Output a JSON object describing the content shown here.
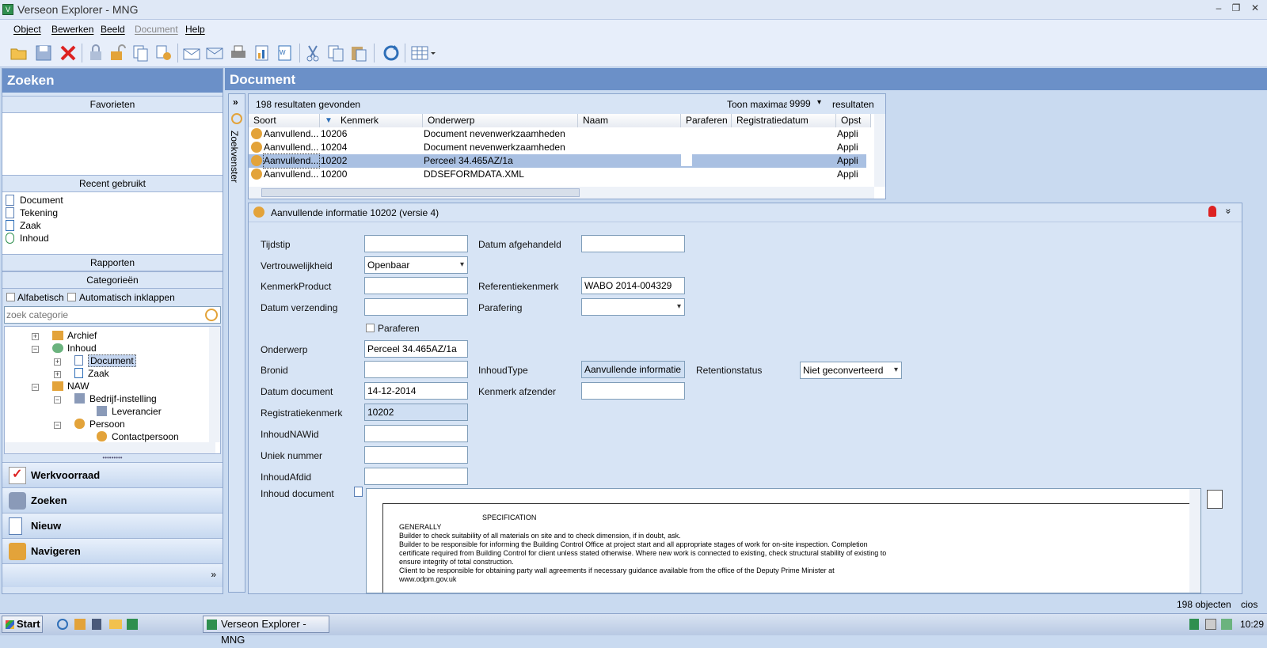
{
  "window": {
    "title": "Verseon Explorer - MNG",
    "app_icon": "verseon-app-icon"
  },
  "menu": [
    "Object",
    "Bewerken",
    "Beeld",
    "Document",
    "Help"
  ],
  "toolbar": [
    "open-folder-icon",
    "save-icon",
    "delete-icon",
    "lock-icon",
    "unlock-icon",
    "copy-doc-icon",
    "check-out-icon",
    "mail-open-icon",
    "mail-send-icon",
    "print-icon",
    "report-icon",
    "word-icon",
    "excel-icon",
    "cut-icon",
    "copy-icon",
    "paste-icon",
    "refresh-icon",
    "grid-view-icon"
  ],
  "left": {
    "title": "Zoeken",
    "favorieten": "Favorieten",
    "recent_title": "Recent gebruikt",
    "recent": [
      "Document",
      "Tekening",
      "Zaak",
      "Inhoud"
    ],
    "rapporten": "Rapporten",
    "categorieen": "Categorieën",
    "alfabetisch": "Alfabetisch",
    "auto_inklappen": "Automatisch inklappen",
    "search_placeholder": "zoek categorie",
    "tree": [
      "Archief",
      "Inhoud",
      "Document",
      "Zaak",
      "NAW",
      "Bedrijf-instelling",
      "Leverancier",
      "Persoon",
      "Contactpersoon"
    ],
    "nav": [
      "Werkvoorraad",
      "Zoeken",
      "Nieuw",
      "Navigeren"
    ]
  },
  "right": {
    "title": "Document",
    "zoekvenster": "Zoekvenster",
    "results_text": "198 resultaten gevonden",
    "toon_maximaal": "Toon maximaal",
    "max_value": "9999",
    "resultaten": "resultaten",
    "columns": [
      "Soort",
      "Kenmerk",
      "Onderwerp",
      "Naam",
      "Paraferen",
      "Registratiedatum",
      "Opst"
    ],
    "rows": [
      {
        "soort": "Aanvullend...",
        "kenmerk": "10206",
        "onderwerp": "Document nevenwerkzaamheden",
        "opst": "Appli"
      },
      {
        "soort": "Aanvullend...",
        "kenmerk": "10204",
        "onderwerp": "Document nevenwerkzaamheden",
        "opst": "Appli"
      },
      {
        "soort": "Aanvullend...",
        "kenmerk": "10202",
        "onderwerp": "Perceel 34.465AZ/1a",
        "opst": "Appli"
      },
      {
        "soort": "Aanvullend...",
        "kenmerk": "10200",
        "onderwerp": "DDSEFORMDATA.XML",
        "opst": "Appli"
      }
    ],
    "detail_title": "Aanvullende informatie 10202 (versie 4)",
    "form": {
      "tijdstip": "Tijdstip",
      "vertrouwelijkheid": "Vertrouwelijkheid",
      "vertrouwelijkheid_val": "Openbaar",
      "kenmerkproduct": "KenmerkProduct",
      "datum_verzending": "Datum verzending",
      "paraferen": "Paraferen",
      "onderwerp": "Onderwerp",
      "onderwerp_val": "Perceel 34.465AZ/1a",
      "bronid": "Bronid",
      "datum_document": "Datum document",
      "datum_document_val": "14-12-2014",
      "registratiekenmerk": "Registratiekenmerk",
      "registratiekenmerk_val": "10202",
      "inhoudnawid": "InhoudNAWid",
      "uniek_nummer": "Uniek nummer",
      "inhoudafdid": "InhoudAfdid",
      "inhoud_document": "Inhoud document",
      "datum_afgehandeld": "Datum afgehandeld",
      "referentiekenmerk": "Referentiekenmerk",
      "referentiekenmerk_val": "WABO 2014-004329",
      "parafering": "Parafering",
      "inhoudtype": "InhoudType",
      "inhoudtype_val": "Aanvullende informatie",
      "kenmerk_afzender": "Kenmerk afzender",
      "retentionstatus": "Retentionstatus",
      "retentionstatus_val": "Niet geconverteerd"
    },
    "preview": {
      "heading": "SPECIFICATION",
      "sub": "GENERALLY",
      "lines": [
        "Builder to check suitability of all materials on site and to check dimension, if in doubt, ask.",
        "Builder to be responsible for informing the Building Control Office at project start and all appropriate stages of work for on-site inspection. Completion",
        "certificate required from Building Control for client unless stated otherwise. Where new work is connected to existing, check structural stability of existing to",
        "ensure integrity of total construction.",
        "Client to be responsible for obtaining party wall agreements if necessary guidance available from the office of the Deputy Prime Minister at",
        "www.odpm.gov.uk"
      ]
    }
  },
  "status": {
    "count": "198 objecten",
    "user": "cios"
  },
  "taskbar": {
    "start": "Start",
    "task": "Verseon Explorer - MNG",
    "clock": "10:29"
  }
}
